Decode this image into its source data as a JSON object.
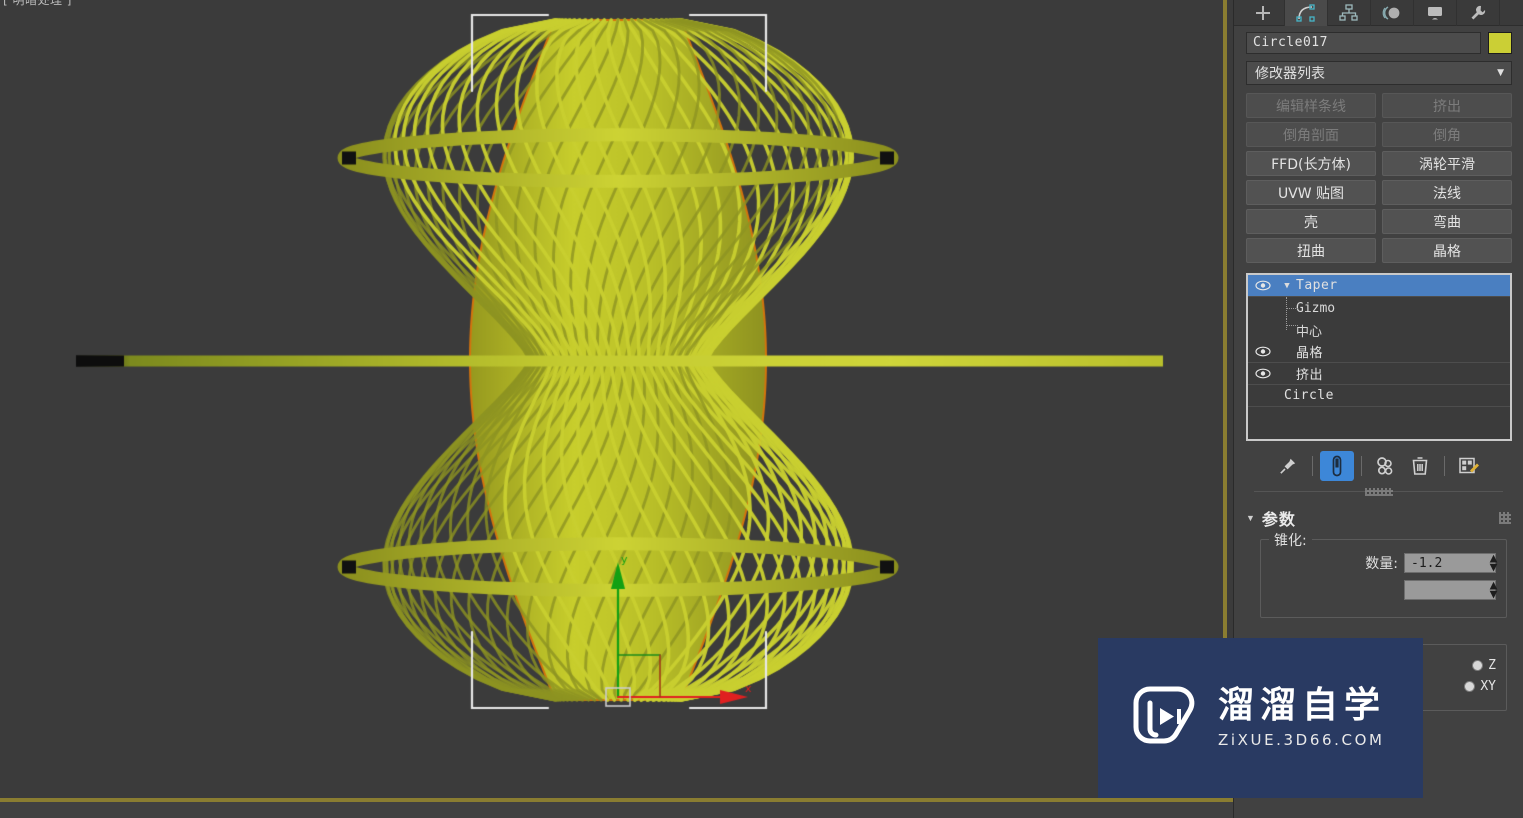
{
  "viewport": {
    "label": "[ 明暗处理 ]",
    "background_color": "#3b3b3b",
    "active_border_color": "#8a7d31",
    "object": {
      "name": "Circle017",
      "wire_color": "#c3c922",
      "edge_color": "#d4740d",
      "description": "lattice-extruded tapered circle, hourglass profile"
    },
    "gizmo": {
      "axis_y_label": "y",
      "axis_x_label": "x",
      "axis_y_color": "#13a013",
      "axis_x_color": "#e02020"
    }
  },
  "command_panel": {
    "tabs": [
      {
        "name": "create-tab",
        "icon": "plus-icon",
        "active": false
      },
      {
        "name": "modify-tab",
        "icon": "bend-icon",
        "active": true
      },
      {
        "name": "hierarchy-tab",
        "icon": "hierarchy-icon",
        "active": false
      },
      {
        "name": "motion-tab",
        "icon": "motion-icon",
        "active": false
      },
      {
        "name": "display-tab",
        "icon": "display-icon",
        "active": false
      },
      {
        "name": "utilities-tab",
        "icon": "wrench-icon",
        "active": false
      }
    ],
    "object_name": "Circle017",
    "object_color": "#cbcf35",
    "modifier_list_label": "修改器列表",
    "modifier_buttons": [
      {
        "label": "编辑样条线",
        "disabled": true
      },
      {
        "label": "挤出",
        "disabled": true
      },
      {
        "label": "倒角剖面",
        "disabled": true
      },
      {
        "label": "倒角",
        "disabled": true
      },
      {
        "label": "FFD(长方体)",
        "disabled": false
      },
      {
        "label": "涡轮平滑",
        "disabled": false
      },
      {
        "label": "UVW 贴图",
        "disabled": false
      },
      {
        "label": "法线",
        "disabled": false
      },
      {
        "label": "壳",
        "disabled": false
      },
      {
        "label": "弯曲",
        "disabled": false
      },
      {
        "label": "扭曲",
        "disabled": false
      },
      {
        "label": "晶格",
        "disabled": false
      }
    ],
    "modifier_stack": [
      {
        "label": "Taper",
        "selected": true,
        "eye": true,
        "expanded": true,
        "type": "modifier"
      },
      {
        "label": "Gizmo",
        "selected": false,
        "eye": false,
        "type": "sub"
      },
      {
        "label": "中心",
        "selected": false,
        "eye": false,
        "type": "sub-last"
      },
      {
        "label": "晶格",
        "selected": false,
        "eye": true,
        "type": "modifier"
      },
      {
        "label": "挤出",
        "selected": false,
        "eye": true,
        "type": "modifier"
      },
      {
        "label": "Circle",
        "selected": false,
        "eye": false,
        "type": "base"
      }
    ],
    "stack_tools": [
      {
        "name": "pin-stack-icon",
        "active": false
      },
      {
        "name": "show-end-result-icon",
        "active": true
      },
      {
        "name": "make-unique-icon",
        "active": false
      },
      {
        "name": "remove-modifier-icon",
        "active": false
      },
      {
        "name": "configure-sets-icon",
        "active": false
      }
    ],
    "rollout": {
      "title": "参数",
      "group_title": "锥化:",
      "amount_label": "数量:",
      "amount_value": "-1.2",
      "axis_z_label": "Z",
      "axis_xy_label": "XY"
    }
  },
  "watermark": {
    "text_cn": "溜溜自学",
    "text_en": "ZiXUE.3D66.COM",
    "bg_color": "#293a62"
  }
}
